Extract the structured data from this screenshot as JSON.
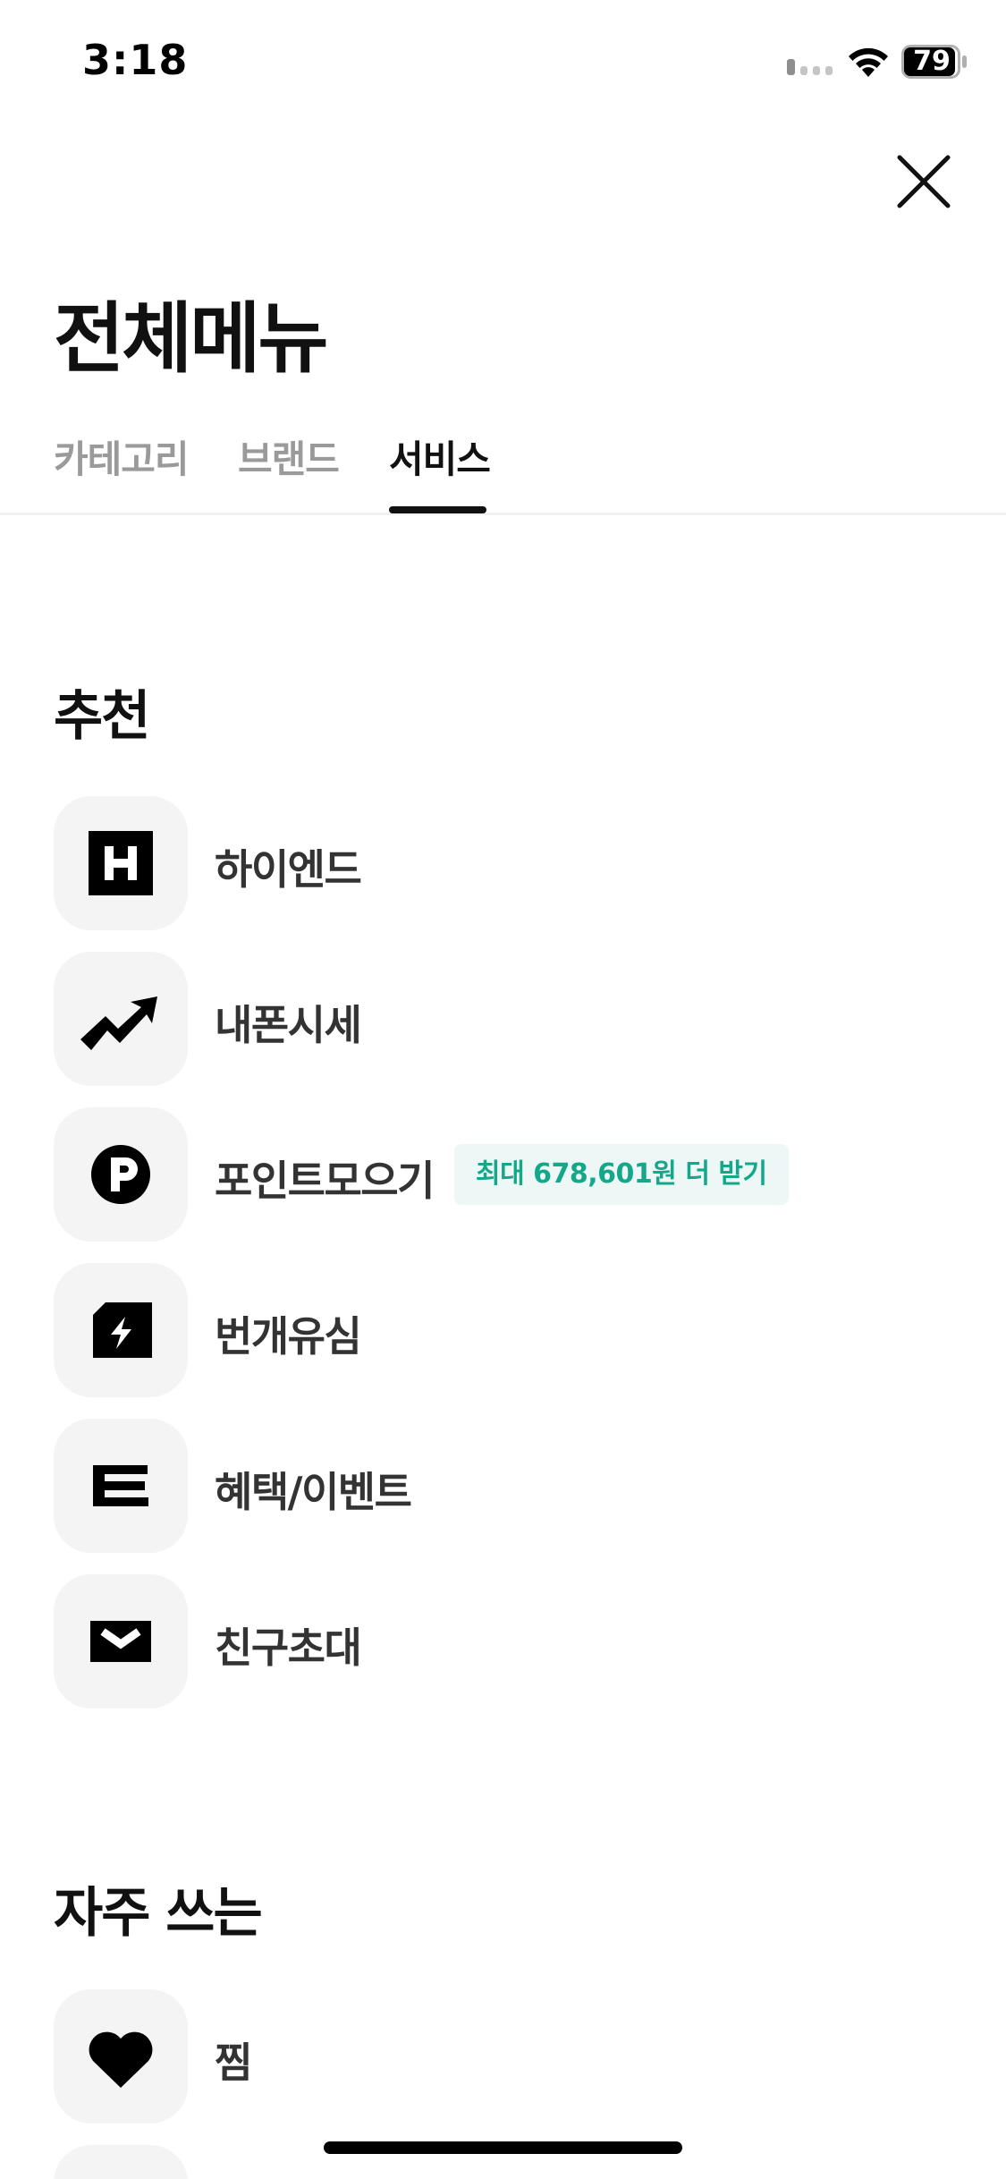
{
  "status_bar": {
    "time": "3:18",
    "battery": "79"
  },
  "header": {
    "title": "전체메뉴"
  },
  "tabs": [
    {
      "label": "카테고리",
      "active": false
    },
    {
      "label": "브랜드",
      "active": false
    },
    {
      "label": "서비스",
      "active": true
    }
  ],
  "sections": [
    {
      "title": "추천",
      "items": [
        {
          "label": "하이엔드",
          "icon": "h-square-icon"
        },
        {
          "label": "내폰시세",
          "icon": "trend-arrow-icon"
        },
        {
          "label": "포인트모으기",
          "icon": "point-p-icon",
          "badge": "최대 678,601원 더 받기"
        },
        {
          "label": "번개유심",
          "icon": "lightning-sim-icon"
        },
        {
          "label": "혜택/이벤트",
          "icon": "e-letter-icon"
        },
        {
          "label": "친구초대",
          "icon": "envelope-icon"
        }
      ]
    },
    {
      "title": "자주 쓰는",
      "items": [
        {
          "label": "찜",
          "icon": "heart-icon"
        }
      ]
    }
  ],
  "colors": {
    "accent_text": "#111111",
    "inactive_tab": "#9a9a9a",
    "icon_bg": "#f4f4f4",
    "badge_bg": "#edf8f6",
    "badge_text": "#14a78a"
  }
}
